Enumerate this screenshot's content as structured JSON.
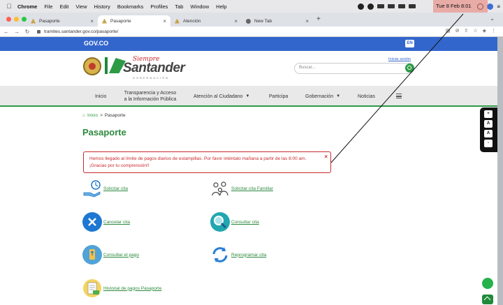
{
  "menubar": {
    "app": "Chrome",
    "items": [
      "File",
      "Edit",
      "View",
      "History",
      "Bookmarks",
      "Profiles",
      "Tab",
      "Window",
      "Help"
    ],
    "clock": "Tue 8 Feb  8:01"
  },
  "tabs": [
    {
      "label": "Pasaporte"
    },
    {
      "label": "Pasaporte"
    },
    {
      "label": "Atención"
    },
    {
      "label": "New Tab"
    }
  ],
  "address": {
    "url": "tramites.santander.gov.co/pasaporte/"
  },
  "gov": {
    "logo": "GOV.CO",
    "lang": "EN"
  },
  "header": {
    "logo_sub": "Siempre",
    "logo_main": "Santander",
    "logo_gob": "GOBERNACIÓN",
    "login": "Iniciar sesión",
    "search_placeholder": "Buscar..."
  },
  "nav": {
    "inicio": "Inicio",
    "transparencia_1": "Transparencia y Acceso",
    "transparencia_2": "a la Información Pública",
    "atencion": "Atención al Ciudadano",
    "participa": "Participa",
    "gobernacion": "Gobernación",
    "noticias": "Noticias"
  },
  "breadcrumb": {
    "home": "Inicio",
    "sep": ">",
    "current": "Pasaporte"
  },
  "page_title": "Pasaporte",
  "alert": {
    "text": "Hemos llegado al límite de pagos diarios de estampillas. Por favor inténtalo mañana a partir de las 8:00 am. ¡Gracias por tu comprensión!!",
    "close": "×"
  },
  "options": {
    "solicitar": "Solicitar cita",
    "solicitar_familiar": "Solicitar cita Familiar",
    "cancelar": "Cancelar cita",
    "consultar": "Consultar cita",
    "consultar_pago": "Consultar el pago",
    "reprogramar": "Reprogramar cita",
    "historial": "Historial de pagos Pasaporte"
  },
  "side_tools": [
    "+",
    "A",
    "A",
    "-"
  ]
}
